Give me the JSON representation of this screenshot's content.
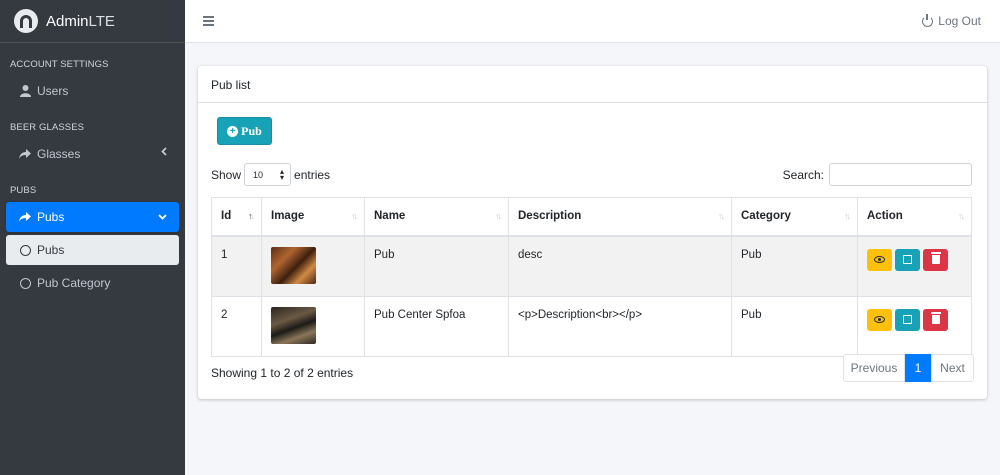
{
  "brand": {
    "name_bold": "Admin",
    "name_light": "LTE"
  },
  "sidebar": {
    "sections": [
      {
        "header": "ACCOUNT SETTINGS",
        "items": [
          {
            "label": "Users",
            "icon": "user-icon"
          }
        ]
      },
      {
        "header": "BEER GLASSES",
        "items": [
          {
            "label": "Glasses",
            "icon": "share-icon"
          }
        ]
      },
      {
        "header": "PUBS",
        "items": [
          {
            "label": "Pubs",
            "icon": "share-icon",
            "state": "expanded-active"
          },
          {
            "label": "Pubs",
            "icon": "circle-icon",
            "state": "sub-active"
          },
          {
            "label": "Pub Category",
            "icon": "circle-icon"
          }
        ]
      }
    ]
  },
  "topbar": {
    "logout_label": "Log Out"
  },
  "card": {
    "title": "Pub list",
    "add_button": "Pub",
    "show_label": "Show",
    "entries_label": "entries",
    "page_length": "10",
    "search_label": "Search:",
    "search_value": ""
  },
  "table": {
    "columns": [
      "Id",
      "Image",
      "Name",
      "Description",
      "Category",
      "Action"
    ],
    "rows": [
      {
        "id": "1",
        "name": "Pub",
        "description": "desc",
        "category": "Pub"
      },
      {
        "id": "2",
        "name": "Pub Center Spfoa",
        "description": "<p>Description<br></p>",
        "category": "Pub"
      }
    ],
    "info": "Showing 1 to 2 of 2 entries",
    "pagination": {
      "previous": "Previous",
      "current": "1",
      "next": "Next"
    }
  },
  "colors": {
    "primary": "#007bff",
    "info": "#17a2b8",
    "warning": "#ffc107",
    "danger": "#dc3545",
    "sidebar": "#343a40"
  }
}
